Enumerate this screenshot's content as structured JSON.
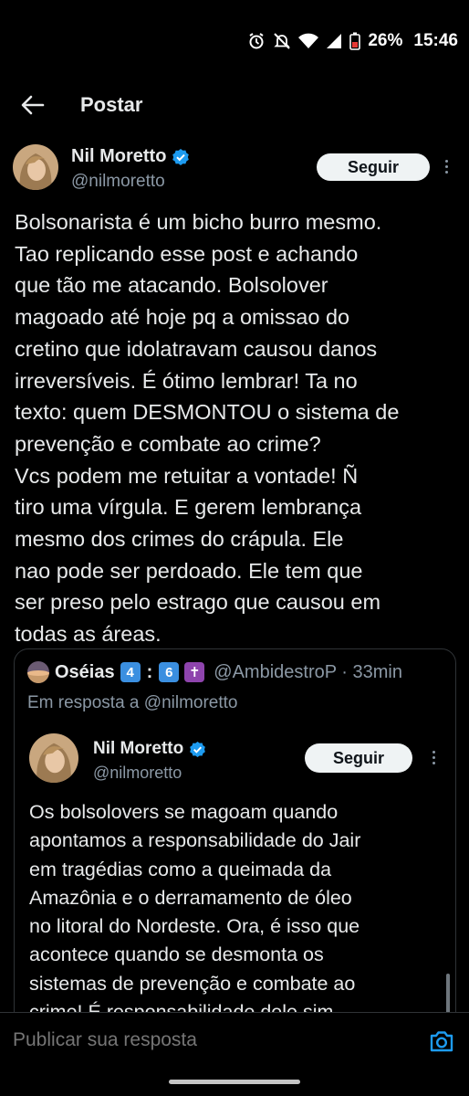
{
  "status_bar": {
    "battery_percent": "26%",
    "time": "15:46",
    "icons": [
      "alarm-icon",
      "mute-icon",
      "wifi-icon",
      "signal-icon",
      "battery-icon"
    ]
  },
  "header": {
    "title": "Postar",
    "back_icon": "arrow-left-icon"
  },
  "post": {
    "author_name": "Nil Moretto",
    "author_handle": "@nilmoretto",
    "verified": true,
    "follow_label": "Seguir",
    "text": "Bolsonarista é um bicho burro mesmo.\nTao replicando esse post e achando\nque tão me atacando. Bolsolover\nmagoado até hoje pq a omissao do\ncretino que idolatravam causou danos\nirreversíveis. É ótimo lembrar!  Ta no\ntexto: quem DESMONTOU o sistema de\nprevenção e combate ao crime?\nVcs podem me retuitar a vontade! Ñ\ntiro uma vírgula. E gerem lembrança\nmesmo dos crimes do crápula. Ele\nnao pode ser perdoado. Ele tem que\nser preso pelo estrago que causou em\ntodas as áreas."
  },
  "quote": {
    "name": "Oséias",
    "emoji_1": "4",
    "emoji_sep": ":",
    "emoji_2": "6",
    "emoji_3": "✝",
    "handle_time": "@AmbidestroP · 33min",
    "reply_to": "Em resposta a @nilmoretto",
    "inner": {
      "author_name": "Nil Moretto",
      "author_handle": "@nilmoretto",
      "follow_label": "Seguir",
      "text": "Os bolsolovers se magoam quando\napontamos a responsabilidade do Jair\nem tragédias como a queimada da\nAmazônia e o derramamento de óleo\nno litoral do Nordeste. Ora, é isso que\nacontece quando se desmonta os\nsistemas de prevenção e combate ao\ncrime! É responsabilidade dele sim."
    }
  },
  "reply_bar": {
    "placeholder": "Publicar sua resposta",
    "camera_icon": "camera-icon"
  },
  "colors": {
    "background": "#000000",
    "text": "#e7e9ea",
    "muted": "#8b98a5",
    "verified": "#1d9bf0",
    "border": "#2f3336"
  }
}
